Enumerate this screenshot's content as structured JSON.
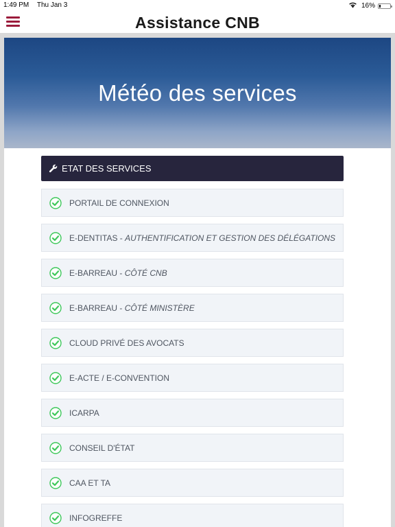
{
  "status_bar": {
    "time": "1:49 PM",
    "date": "Thu Jan 3",
    "battery": "16%",
    "battery_level": 0.16
  },
  "nav": {
    "title": "Assistance CNB"
  },
  "hero": {
    "title": "Météo des services"
  },
  "section": {
    "title": "ETAT DES SERVICES"
  },
  "colors": {
    "accent": "#9b1b3b",
    "header_bg": "#27253d",
    "status_ok": "#3ec85a"
  },
  "services": [
    {
      "name": "PORTAIL DE CONNEXION",
      "subtitle": "",
      "status": "ok"
    },
    {
      "name": "E-DENTITAS",
      "subtitle": "AUTHENTIFICATION ET GESTION DES DÉLÉGATIONS",
      "status": "ok"
    },
    {
      "name": "E-BARREAU",
      "subtitle": "CÔTÉ CNB",
      "status": "ok"
    },
    {
      "name": "E-BARREAU",
      "subtitle": "CÔTÉ MINISTÈRE",
      "status": "ok"
    },
    {
      "name": "CLOUD PRIVÉ DES AVOCATS",
      "subtitle": "",
      "status": "ok"
    },
    {
      "name": "E-ACTE / E-CONVENTION",
      "subtitle": "",
      "status": "ok"
    },
    {
      "name": "ICARPA",
      "subtitle": "",
      "status": "ok"
    },
    {
      "name": "CONSEIL D'ÉTAT",
      "subtitle": "",
      "status": "ok"
    },
    {
      "name": "CAA ET TA",
      "subtitle": "",
      "status": "ok"
    },
    {
      "name": "INFOGREFFE",
      "subtitle": "",
      "status": "ok"
    }
  ]
}
